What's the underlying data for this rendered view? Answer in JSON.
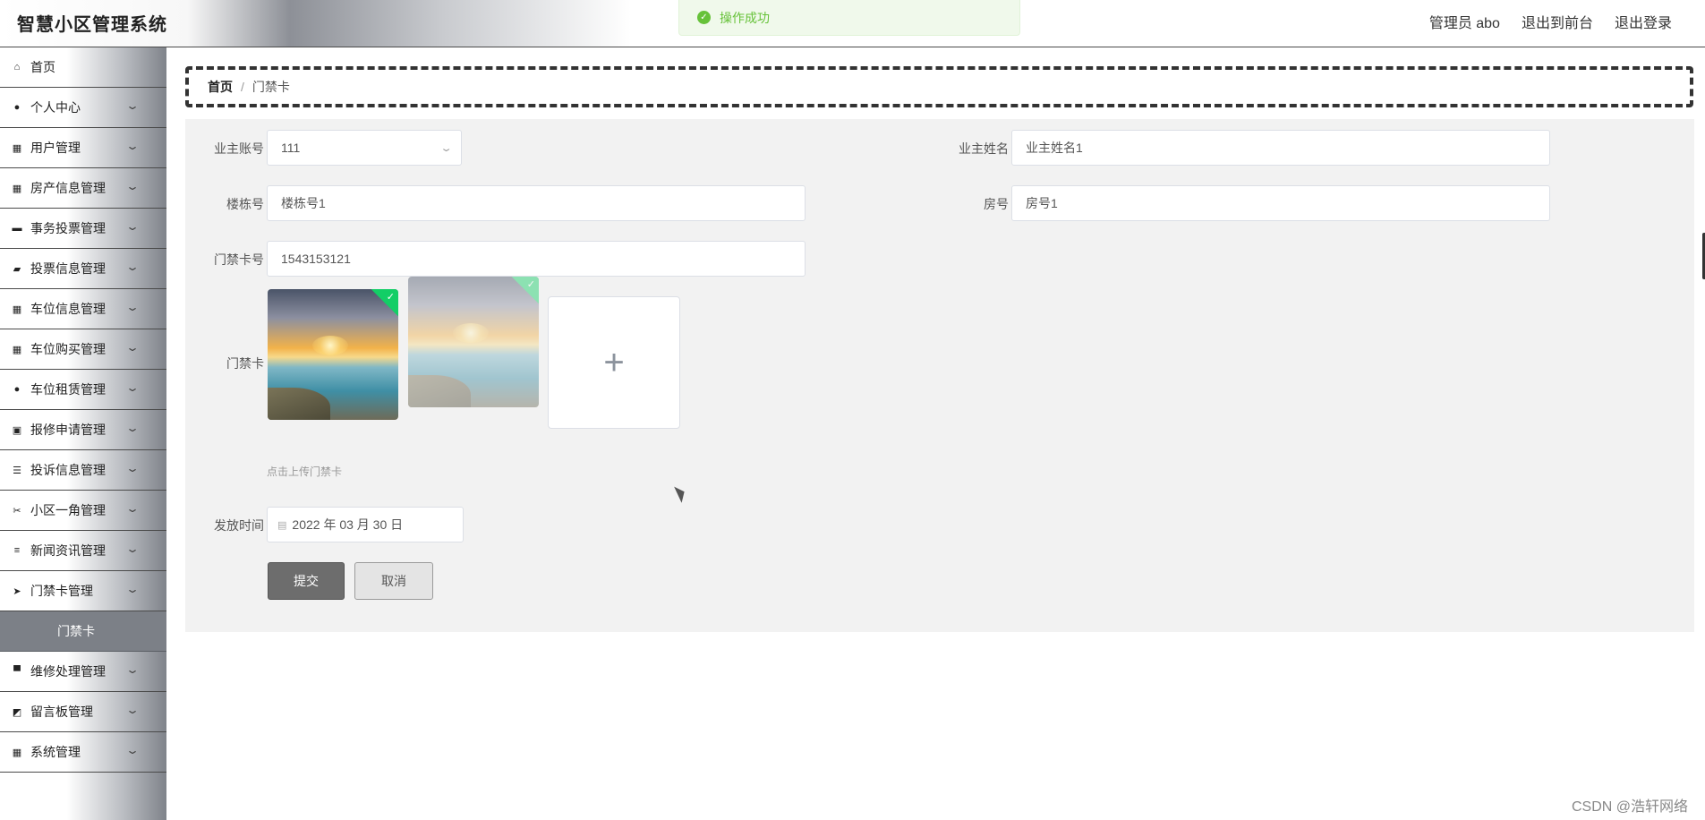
{
  "header": {
    "title": "智慧小区管理系统",
    "user_label": "管理员 abo",
    "to_front": "退出到前台",
    "logout": "退出登录"
  },
  "toast": {
    "message": "操作成功",
    "color": "#67c23a"
  },
  "sidebar": {
    "items": [
      {
        "label": "首页",
        "icon": "home-icon"
      },
      {
        "label": "个人中心",
        "icon": "user-icon"
      },
      {
        "label": "用户管理",
        "icon": "grid-icon"
      },
      {
        "label": "房产信息管理",
        "icon": "apps-icon"
      },
      {
        "label": "事务投票管理",
        "icon": "briefcase-icon"
      },
      {
        "label": "投票信息管理",
        "icon": "vote-icon"
      },
      {
        "label": "车位信息管理",
        "icon": "grid-icon"
      },
      {
        "label": "车位购买管理",
        "icon": "grid-icon"
      },
      {
        "label": "车位租赁管理",
        "icon": "location-icon"
      },
      {
        "label": "报修申请管理",
        "icon": "clipboard-icon"
      },
      {
        "label": "投诉信息管理",
        "icon": "list-icon"
      },
      {
        "label": "小区一角管理",
        "icon": "ticket-icon"
      },
      {
        "label": "新闻资讯管理",
        "icon": "sliders-icon"
      },
      {
        "label": "门禁卡管理",
        "icon": "send-icon"
      },
      {
        "label": "维修处理管理",
        "icon": "sign-icon"
      },
      {
        "label": "留言板管理",
        "icon": "chart-icon"
      },
      {
        "label": "系统管理",
        "icon": "grid-icon"
      }
    ],
    "sub_active": "门禁卡"
  },
  "breadcrumb": {
    "home": "首页",
    "separator": "/",
    "current": "门禁卡"
  },
  "form": {
    "owner_account_label": "业主账号",
    "owner_account_value": "111",
    "owner_name_label": "业主姓名",
    "owner_name_value": "业主姓名1",
    "building_label": "楼栋号",
    "building_value": "楼栋号1",
    "room_label": "房号",
    "room_value": "房号1",
    "card_no_label": "门禁卡号",
    "card_no_value": "1543153121",
    "card_image_label": "门禁卡",
    "upload_tip": "点击上传门禁卡",
    "issue_time_label": "发放时间",
    "issue_time_value": "2022 年 03 月 30 日",
    "submit": "提交",
    "cancel": "取消"
  },
  "watermark": "CSDN @浩轩网络"
}
